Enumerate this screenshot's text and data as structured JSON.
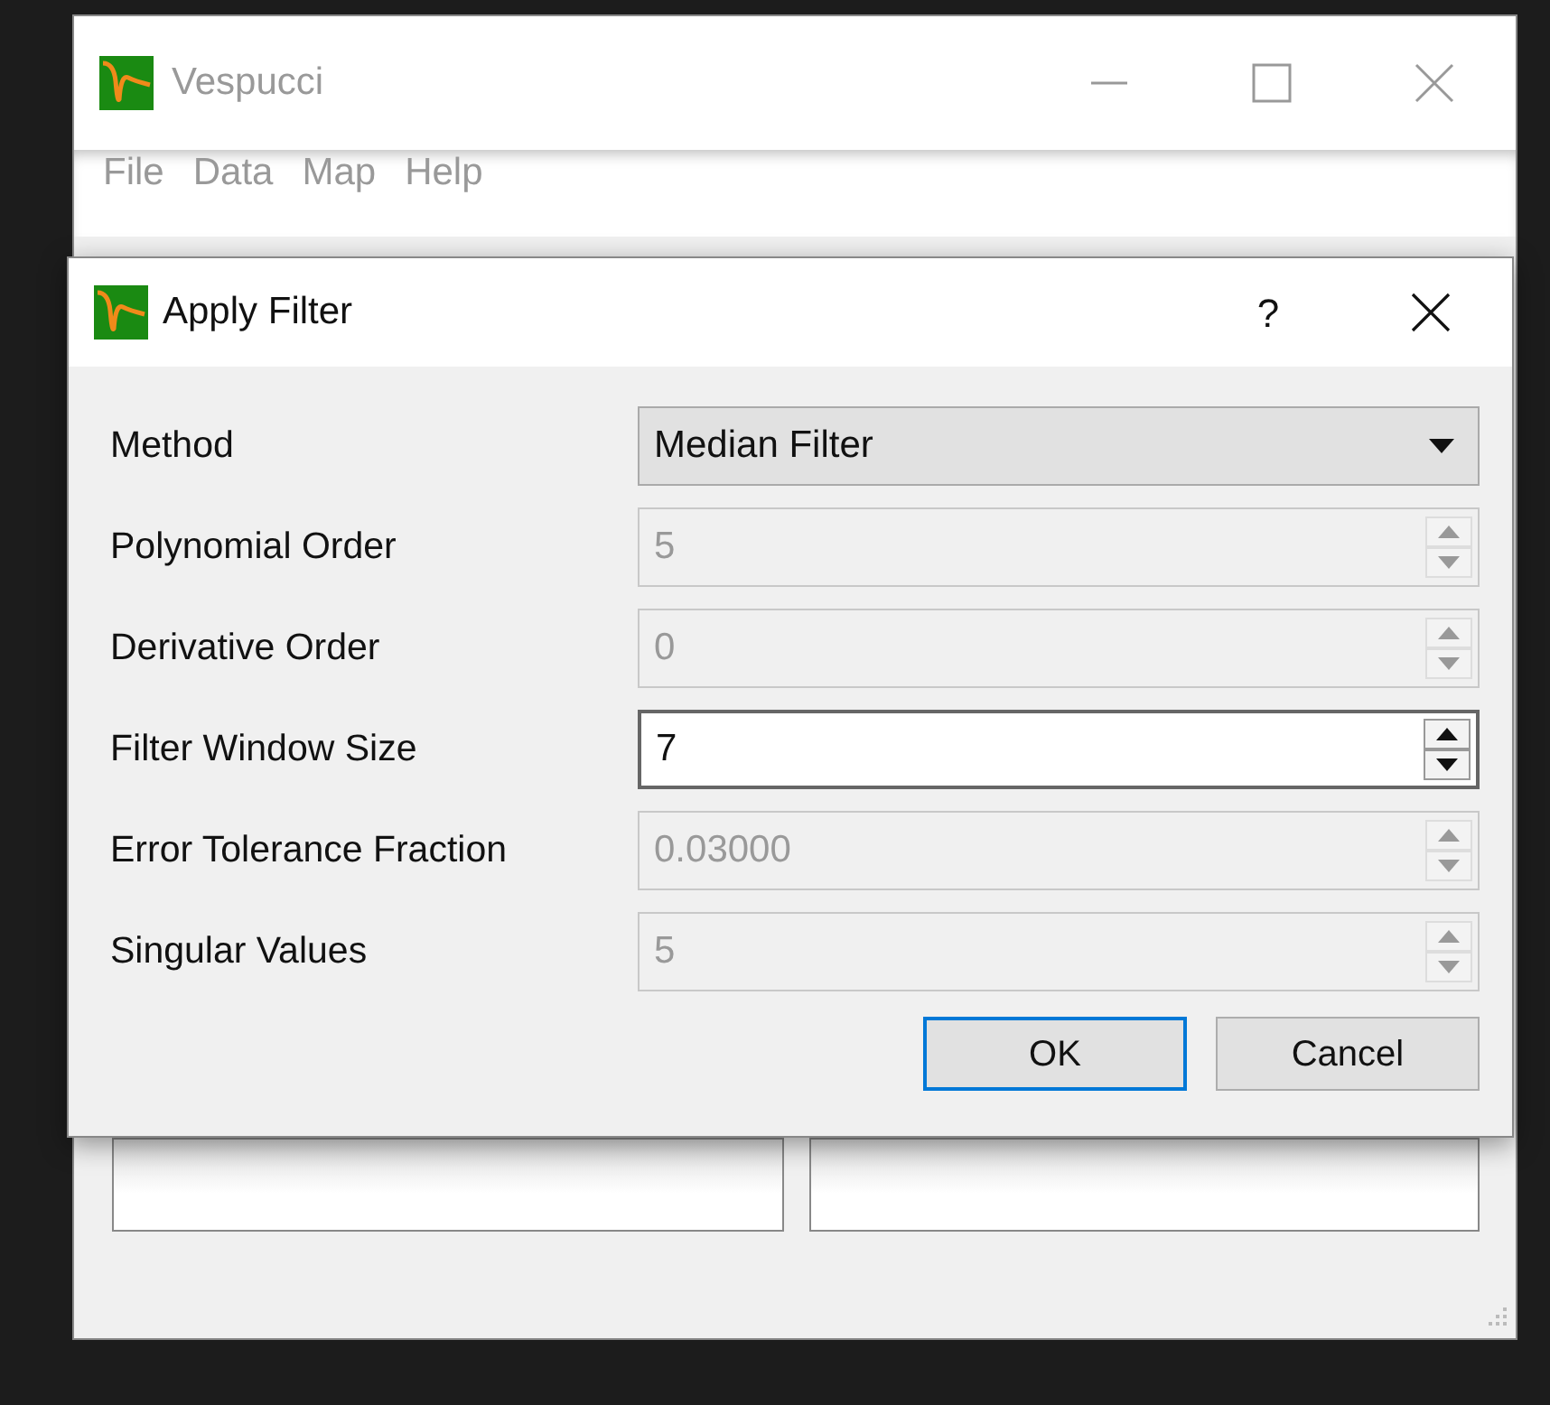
{
  "main_window": {
    "title": "Vespucci",
    "active": false,
    "menu": [
      "File",
      "Data",
      "Map",
      "Help"
    ]
  },
  "dialog": {
    "title": "Apply Filter",
    "help": "?",
    "fields": [
      {
        "label": "Method",
        "kind": "combo",
        "value": "Median Filter",
        "disabled": false,
        "focused": false
      },
      {
        "label": "Polynomial Order",
        "kind": "spin",
        "value": "5",
        "disabled": true,
        "focused": false
      },
      {
        "label": "Derivative Order",
        "kind": "spin",
        "value": "0",
        "disabled": true,
        "focused": false
      },
      {
        "label": "Filter Window Size",
        "kind": "spin",
        "value": "7",
        "disabled": false,
        "focused": true
      },
      {
        "label": "Error Tolerance Fraction",
        "kind": "spin",
        "value": "0.03000",
        "disabled": true,
        "focused": false
      },
      {
        "label": "Singular Values",
        "kind": "spin",
        "value": "5",
        "disabled": true,
        "focused": false
      }
    ],
    "buttons": [
      {
        "label": "OK",
        "default": true
      },
      {
        "label": "Cancel",
        "default": false
      }
    ]
  }
}
